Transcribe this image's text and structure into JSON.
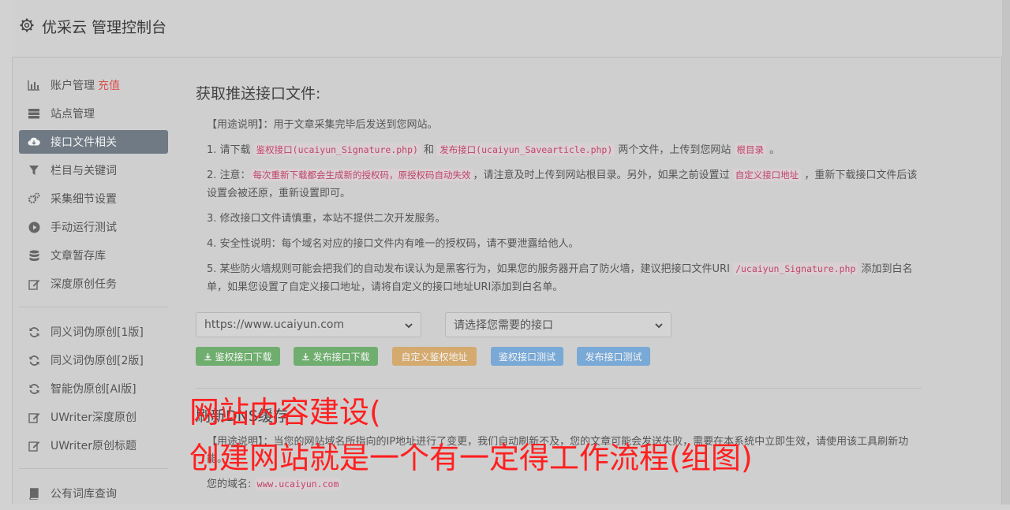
{
  "header": {
    "title": "优采云 管理控制台",
    "icon": "gear-icon"
  },
  "sidebar": {
    "group1": [
      {
        "label": "账户管理",
        "badge": "充值",
        "icon": "bar-chart-icon"
      },
      {
        "label": "站点管理",
        "icon": "server-icon"
      },
      {
        "label": "接口文件相关",
        "icon": "cloud-download-icon",
        "active": true
      },
      {
        "label": "栏目与关键词",
        "icon": "filter-icon"
      },
      {
        "label": "采集细节设置",
        "icon": "cogs-icon"
      },
      {
        "label": "手动运行测试",
        "icon": "play-circle-icon"
      },
      {
        "label": "文章暂存库",
        "icon": "database-icon"
      },
      {
        "label": "深度原创任务",
        "icon": "edit-icon"
      }
    ],
    "group2": [
      {
        "label": "同义词伪原创[1版]",
        "icon": "refresh-icon"
      },
      {
        "label": "同义词伪原创[2版]",
        "icon": "refresh-icon"
      },
      {
        "label": "智能伪原创[AI版]",
        "icon": "refresh-icon"
      },
      {
        "label": "UWriter深度原创",
        "icon": "edit-icon"
      },
      {
        "label": "UWriter原创标题",
        "icon": "edit-icon"
      }
    ],
    "group3": [
      {
        "label": "公有词库查询",
        "icon": "book-icon"
      }
    ]
  },
  "main": {
    "title": "获取推送接口文件:",
    "p0": "【用途说明】：用于文章采集完毕后发送到您网站。",
    "p1": {
      "a": "1. 请下载 ",
      "c1": "鉴权接口(ucaiyun_Signature.php)",
      "b": " 和 ",
      "c2": "发布接口(ucaiyun_Savearticle.php)",
      "c": " 两个文件，上传到您网站 ",
      "c3": "根目录",
      "d": " 。"
    },
    "p2": {
      "a": "2. 注意：",
      "c1": "每次重新下载都会生成新的授权码，原授权码自动失效",
      "b": "，请注意及时上传到网站根目录。另外，如果之前设置过 ",
      "c2": "自定义接口地址",
      "c": " ，重新下载接口文件后该设置会被还原，重新设置即可。"
    },
    "p3": "3. 修改接口文件请慎重，本站不提供二次开发服务。",
    "p4": "4. 安全性说明：每个域名对应的接口文件内有唯一的授权码，请不要泄露给他人。",
    "p5": {
      "a": "5. 某些防火墙规则可能会把我们的自动发布误认为是黑客行为，如果您的服务器开启了防火墙，建议把接口文件URI ",
      "c1": "/ucaiyun_Signature.php",
      "b": " 添加到白名单，如果您设置了自定义接口地址，请将自定义的接口地址URI添加到白名单。"
    },
    "site_select": "https://www.ucaiyun.com",
    "api_select": "请选择您需要的接口",
    "buttons": {
      "sig_download": "鉴权接口下载",
      "pub_download": "发布接口下载",
      "custom_url": "自定义鉴权地址",
      "sig_test": "鉴权接口测试",
      "pub_test": "发布接口测试"
    },
    "dns_title": "刷新DNS缓存",
    "dns_desc": "【用途说明】：当您的网站域名所指向的IP地址进行了变更，我们自动刷新不及，您的文章可能会发送失败，需要在本系统中立即生效，请使用该工具刷新功能。",
    "domain_label": "您的域名: ",
    "domain_value": "www.ucaiyun.com"
  },
  "overlay": {
    "line1": "网站内容建设(",
    "line2": "创建网站就是一个有一定得工作流程(组图)"
  }
}
